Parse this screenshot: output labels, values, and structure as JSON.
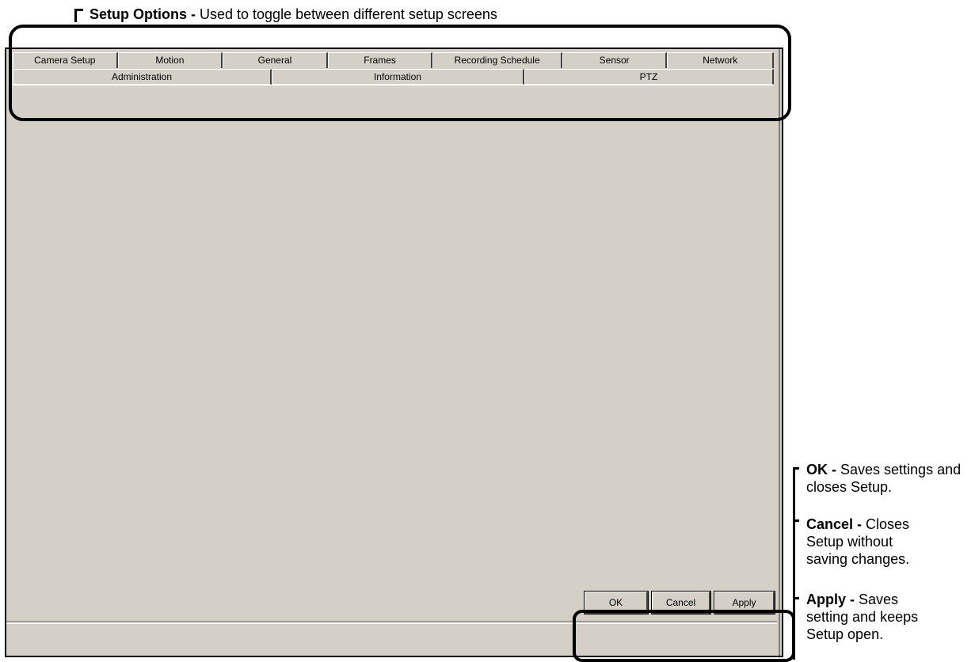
{
  "setup_options_annotation": {
    "bold": "Setup Options -",
    "text": " Used to toggle between different setup screens"
  },
  "tabs_row1": [
    {
      "label": "Camera Setup"
    },
    {
      "label": "Motion"
    },
    {
      "label": "General"
    },
    {
      "label": "Frames"
    },
    {
      "label": "Recording Schedule"
    },
    {
      "label": "Sensor"
    },
    {
      "label": "Network"
    }
  ],
  "tabs_row2": [
    {
      "label": "Administration"
    },
    {
      "label": "Information"
    },
    {
      "label": "PTZ"
    }
  ],
  "buttons": {
    "ok": "OK",
    "cancel": "Cancel",
    "apply": "Apply"
  },
  "annotations": {
    "ok": {
      "bold": "OK -",
      "text": " Saves settings and closes Setup."
    },
    "cancel": {
      "bold": "Cancel -",
      "text": " Closes Setup without saving changes."
    },
    "apply": {
      "bold": "Apply -",
      "text": " Saves setting and keeps Setup open."
    }
  }
}
